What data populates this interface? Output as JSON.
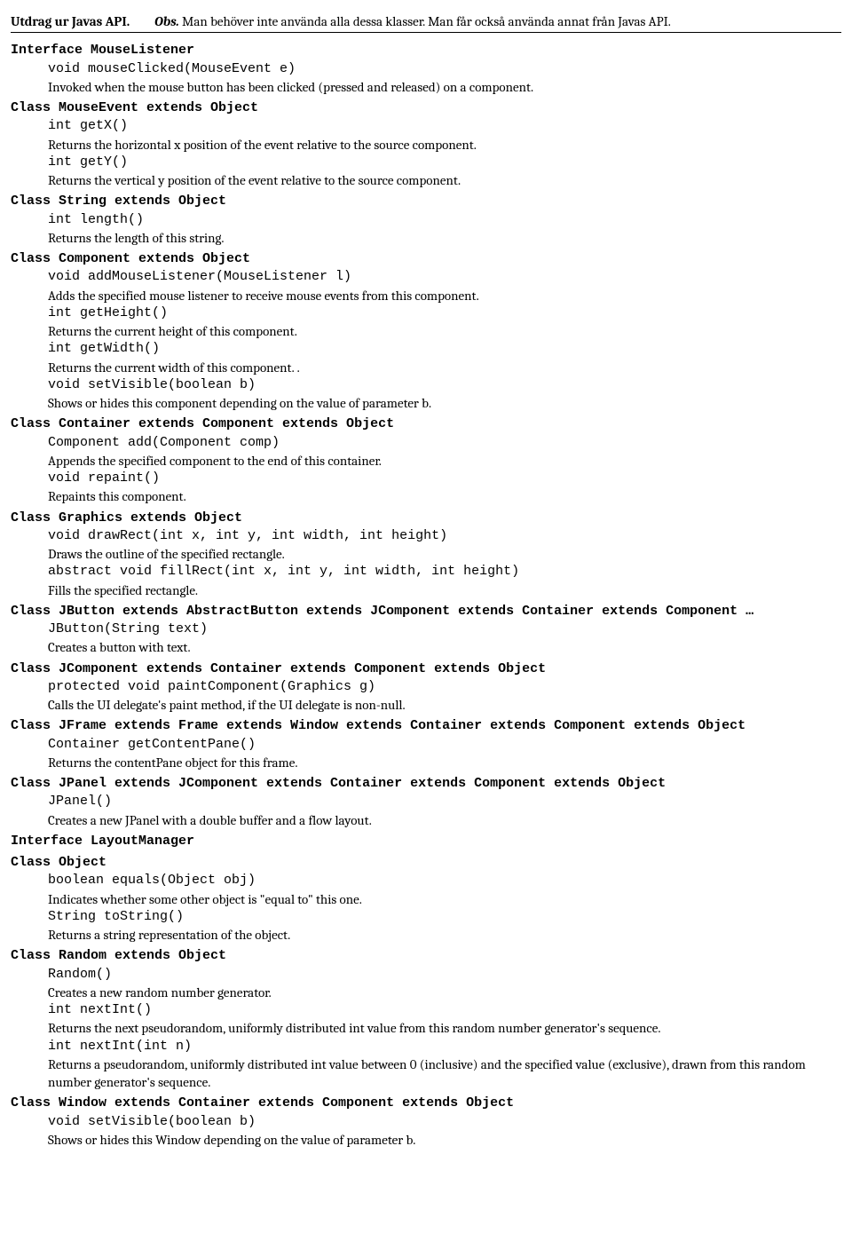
{
  "header": {
    "title": "Utdrag ur Javas API.",
    "obs_label": "Obs.",
    "note": " Man behöver inte använda alla dessa klasser. Man får också använda annat från Javas API."
  },
  "sections": [
    {
      "head": "Interface MouseListener",
      "members": [
        {
          "sig": "void mouseClicked(MouseEvent e)",
          "desc": "Invoked when the mouse button has been clicked (pressed and released) on a component."
        }
      ]
    },
    {
      "head": "Class MouseEvent extends Object",
      "members": [
        {
          "sig": "int getX()",
          "desc": "Returns the horizontal x position of the event relative to the source component."
        },
        {
          "sig": "int getY()",
          "desc": "Returns the vertical y position of the event relative to the source component."
        }
      ]
    },
    {
      "head": "Class String extends Object",
      "members": [
        {
          "sig": "int length()",
          "desc": "Returns the length of this string."
        }
      ]
    },
    {
      "head": "Class Component extends Object",
      "members": [
        {
          "sig": "void addMouseListener(MouseListener l)",
          "desc": "Adds the specified mouse listener to receive mouse events from this component."
        },
        {
          "sig": "int getHeight()",
          "desc": "Returns the current height of this component."
        },
        {
          "sig": "int getWidth()",
          "desc": "Returns the current width of this component. ."
        },
        {
          "sig": "void setVisible(boolean b)",
          "desc": "Shows or hides this component depending on the value of parameter b."
        }
      ]
    },
    {
      "head": "Class Container extends Component extends Object",
      "members": [
        {
          "sig": "Component add(Component comp)",
          "desc": "Appends the specified component to the end of this container."
        },
        {
          "sig": "void repaint()",
          "desc": "Repaints this component."
        }
      ]
    },
    {
      "head": "Class Graphics extends Object",
      "members": [
        {
          "sig": "void drawRect(int x, int y, int width, int height)",
          "desc": "Draws the outline of the specified rectangle."
        },
        {
          "sig": "abstract void fillRect(int x, int y, int width, int height)",
          "desc": "Fills the specified rectangle."
        }
      ]
    },
    {
      "head": "Class JButton extends AbstractButton extends JComponent extends Container extends Component …",
      "members": [
        {
          "sig": "JButton(String text)",
          "desc": "Creates a button with text."
        }
      ]
    },
    {
      "head": "Class JComponent extends Container extends Component extends Object",
      "members": [
        {
          "sig": "protected void paintComponent(Graphics g)",
          "desc": "Calls the UI delegate's paint method, if the UI delegate is non-null."
        }
      ]
    },
    {
      "head": "Class JFrame extends Frame extends Window extends Container extends Component extends Object",
      "members": [
        {
          "sig": "Container getContentPane()",
          "desc": "Returns the contentPane object for this frame."
        }
      ]
    },
    {
      "head": "Class JPanel extends JComponent extends Container extends Component extends Object",
      "members": [
        {
          "sig": "JPanel()",
          "desc": "Creates a new JPanel with a double buffer and a flow layout."
        }
      ]
    },
    {
      "head": "Interface LayoutManager",
      "members": []
    },
    {
      "head": "Class Object",
      "members": [
        {
          "sig": "boolean equals(Object obj)",
          "desc": "Indicates whether some other object is \"equal to\" this one."
        },
        {
          "sig": "String toString()",
          "desc": "Returns a string representation of the object."
        }
      ]
    },
    {
      "head": "Class Random extends Object",
      "members": [
        {
          "sig": "Random()",
          "desc": "Creates a new random number generator."
        },
        {
          "sig": "int nextInt()",
          "desc": "Returns the next pseudorandom, uniformly distributed int value from this random number generator's sequence."
        },
        {
          "sig": "int nextInt(int n)",
          "desc": "Returns a pseudorandom, uniformly distributed int value between 0 (inclusive) and the specified value (exclusive), drawn from this random number generator's sequence."
        }
      ]
    },
    {
      "head": "Class Window extends Container extends Component extends Object",
      "members": [
        {
          "sig": "void setVisible(boolean b)",
          "desc": "Shows or hides this Window depending on the value of parameter b."
        }
      ]
    }
  ]
}
